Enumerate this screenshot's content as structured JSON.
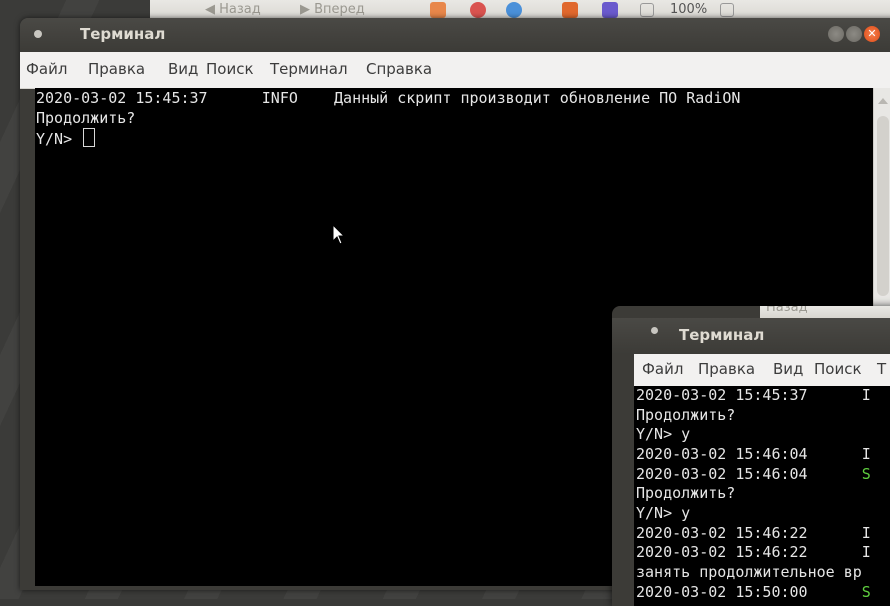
{
  "browser_toolbar": {
    "back_label": "Назад",
    "forward_label": "Вперед",
    "zoom": "100%"
  },
  "main_window": {
    "title": "Терминал",
    "menu": [
      "Файл",
      "Правка",
      "Вид",
      "Поиск",
      "Терминал",
      "Справка"
    ],
    "lines": [
      {
        "timestamp": "2020-03-02 15:45:37",
        "level": "INFO",
        "message": "Данный скрипт производит обновление ПО RadiON"
      },
      {
        "text": "Продолжить?"
      },
      {
        "text": "Y/N> "
      }
    ]
  },
  "second_window": {
    "browser_back_label": "Назад",
    "title": "Терминал",
    "menu": [
      "Файл",
      "Правка",
      "Вид",
      "Поиск",
      "Т"
    ],
    "lines": [
      {
        "timestamp": "2020-03-02 15:45:37",
        "level": "I"
      },
      {
        "text": "Продолжить?"
      },
      {
        "text": "Y/N> y"
      },
      {
        "timestamp": "2020-03-02 15:46:04",
        "level": "I"
      },
      {
        "timestamp": "2020-03-02 15:46:04",
        "level": "S"
      },
      {
        "text": "Продолжить?"
      },
      {
        "text": "Y/N> y"
      },
      {
        "timestamp": "2020-03-02 15:46:22",
        "level": "I"
      },
      {
        "timestamp": "2020-03-02 15:46:22",
        "level": "I"
      },
      {
        "text": "занять продолжительное вр"
      },
      {
        "timestamp": "2020-03-02 15:50:00",
        "level": "S"
      }
    ]
  },
  "colors": {
    "terminal_bg": "#000000",
    "terminal_fg": "#e6e6e6",
    "success_green": "#5fcf3f",
    "titlebar": "#3c3b37",
    "close_button": "#df4b16"
  }
}
